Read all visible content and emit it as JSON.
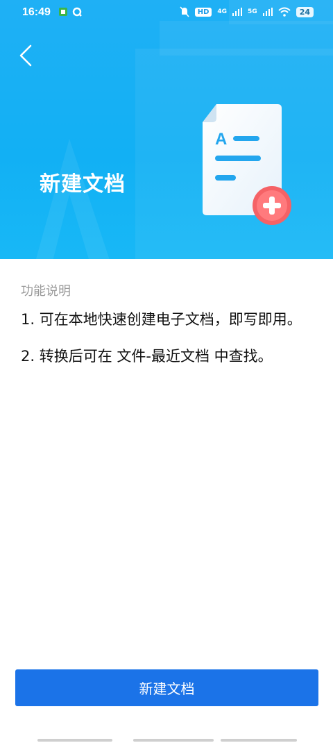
{
  "status_bar": {
    "time": "16:49",
    "left_icons": [
      "app-notification-icon",
      "q-app-icon"
    ],
    "right_icons": [
      "mute-icon",
      "hd-icon",
      "signal-4g-icon",
      "signal-5g-icon",
      "wifi-icon"
    ],
    "hd": "HD",
    "net_4g": "4G",
    "net_5g": "5G",
    "battery": "24"
  },
  "header": {
    "title": "新建文档",
    "back_icon": "chevron-left-icon"
  },
  "description": {
    "section_title": "功能说明",
    "items": [
      "1. 可在本地快速创建电子文档，即写即用。",
      "2. 转换后可在 文件-最近文档 中查找。"
    ]
  },
  "action": {
    "label": "新建文档"
  },
  "colors": {
    "hero_bg": "#15b2f5",
    "button_bg": "#1b73e8",
    "section_title": "#9a9a9a"
  }
}
